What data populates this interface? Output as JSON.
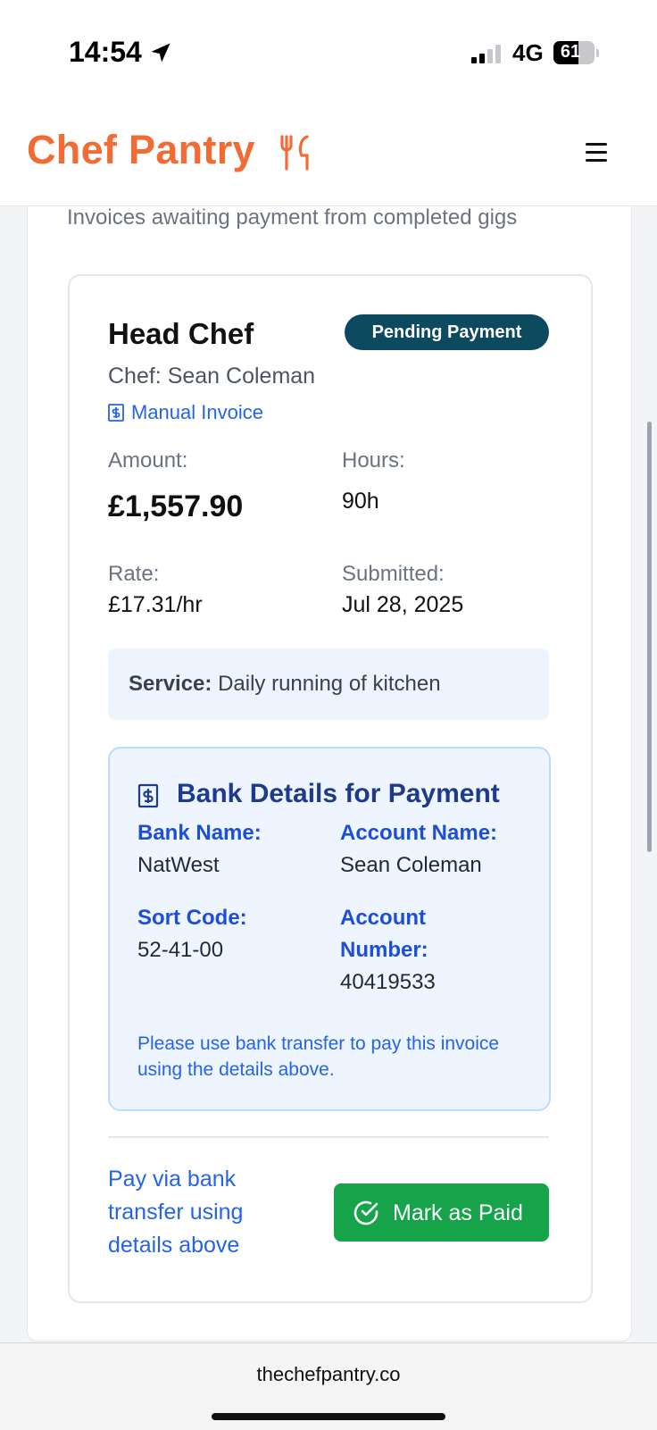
{
  "status_bar": {
    "time": "14:54",
    "network": "4G",
    "battery": "61",
    "battery_level": 0.61
  },
  "header": {
    "brand": "Chef Pantry",
    "brand_color": "#f26b35",
    "menu_icon": "hamburger-menu-icon"
  },
  "page": {
    "subtitle": "Invoices awaiting payment from completed gigs"
  },
  "invoice": {
    "title": "Head Chef",
    "status": "Pending Payment",
    "chef": "Chef: Sean Coleman",
    "invoice_type": "Manual Invoice",
    "amount_label": "Amount:",
    "amount": "£1,557.90",
    "hours_label": "Hours:",
    "hours": "90h",
    "rate_label": "Rate:",
    "rate": "£17.31/hr",
    "submitted_label": "Submitted:",
    "submitted": "Jul 28, 2025",
    "service_label": "Service:",
    "service": "Daily running of kitchen",
    "bank": {
      "title": "Bank Details for Payment",
      "bank_name_label": "Bank Name:",
      "bank_name": "NatWest",
      "account_name_label": "Account Name:",
      "account_name": "Sean Coleman",
      "sort_code_label": "Sort Code:",
      "sort_code": "52-41-00",
      "account_number_label_1": "Account",
      "account_number_label_2": "Number:",
      "account_number": "40419533",
      "note": "Please use bank transfer to pay this invoice using the details above."
    },
    "pay_instruction": "Pay via bank transfer using details above",
    "mark_paid_label": "Mark as Paid",
    "mark_paid_color": "#16a34a"
  },
  "browser": {
    "url": "thechefpantry.co"
  }
}
